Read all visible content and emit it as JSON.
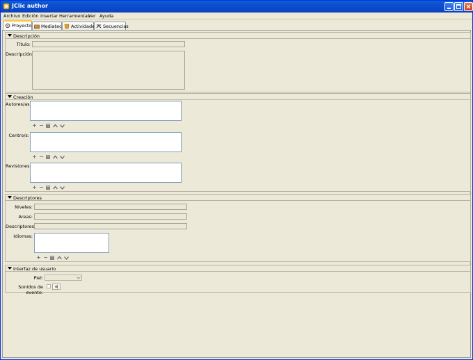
{
  "window": {
    "title": "JClic author"
  },
  "menu": [
    "Archivo",
    "Edición",
    "Insertar",
    "Herramientas",
    "Ver",
    "Ayuda"
  ],
  "tabs": [
    {
      "label": "Proyecto",
      "icon": "gear-icon",
      "active": true
    },
    {
      "label": "Mediateca",
      "icon": "media-icon",
      "active": false
    },
    {
      "label": "Actividades",
      "icon": "activities-icon",
      "active": false
    },
    {
      "label": "Secuencias",
      "icon": "sequences-icon",
      "active": false
    }
  ],
  "descripcion": {
    "title": "Descripción",
    "titulo_label": "Título:",
    "titulo_value": "",
    "descripcion_label": "Descripción:",
    "descripcion_value": ""
  },
  "creacion": {
    "title": "Creación",
    "autores_label": "Autores/as:",
    "centros_label": "Centro/s:",
    "revisiones_label": "Revisiones:"
  },
  "descriptores": {
    "title": "Descriptores",
    "niveles_label": "Niveles:",
    "areas_label": "Areas:",
    "descriptores_label": "Descriptores:",
    "idiomas_label": "Idiomas:"
  },
  "interfaz": {
    "title": "Interfaz de usuario",
    "piel_label": "Piel:",
    "piel_value": "",
    "sonidos_label": "Sonidos de evento:"
  },
  "list_buttons": {
    "add": "+",
    "remove": "−"
  },
  "colors": {
    "titlebar": "#0a4fd0",
    "background": "#ece9d8",
    "tab_highlight": "#ffc73c"
  }
}
